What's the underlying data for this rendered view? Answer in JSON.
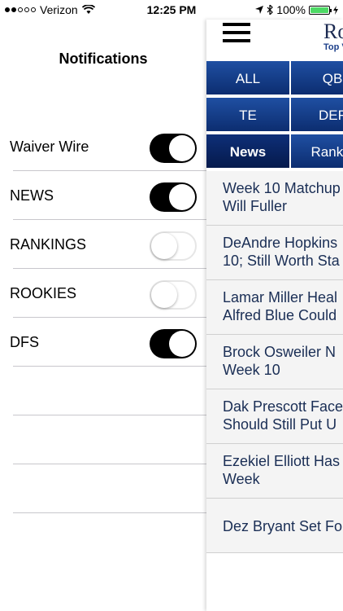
{
  "status": {
    "carrier": "Verizon",
    "time": "12:25 PM",
    "battery": "100%"
  },
  "menu": {
    "title": "Notifications",
    "items": [
      {
        "label": "Waiver Wire",
        "on": true
      },
      {
        "label": "NEWS",
        "on": true
      },
      {
        "label": "RANKINGS",
        "on": false
      },
      {
        "label": "ROOKIES",
        "on": false
      },
      {
        "label": "DFS",
        "on": true
      }
    ]
  },
  "header": {
    "logo": "Ro",
    "logo_sub": "Top V"
  },
  "tabs": {
    "all": "ALL",
    "qb": "QB",
    "te": "TE",
    "def": "DEF",
    "news": "News",
    "rankings": "Rankin"
  },
  "articles": [
    {
      "line1": "Week 10 Matchup",
      "line2": "Will Fuller"
    },
    {
      "line1": "DeAndre Hopkins",
      "line2": "10; Still Worth Sta"
    },
    {
      "line1": "Lamar Miller Heal",
      "line2": "Alfred Blue Could"
    },
    {
      "line1": "Brock Osweiler N",
      "line2": "Week 10"
    },
    {
      "line1": "Dak Prescott Face",
      "line2": "Should Still Put U"
    },
    {
      "line1": "Ezekiel Elliott Has",
      "line2": "Week"
    },
    {
      "line1": "Dez Bryant Set Fo",
      "line2": ""
    }
  ]
}
